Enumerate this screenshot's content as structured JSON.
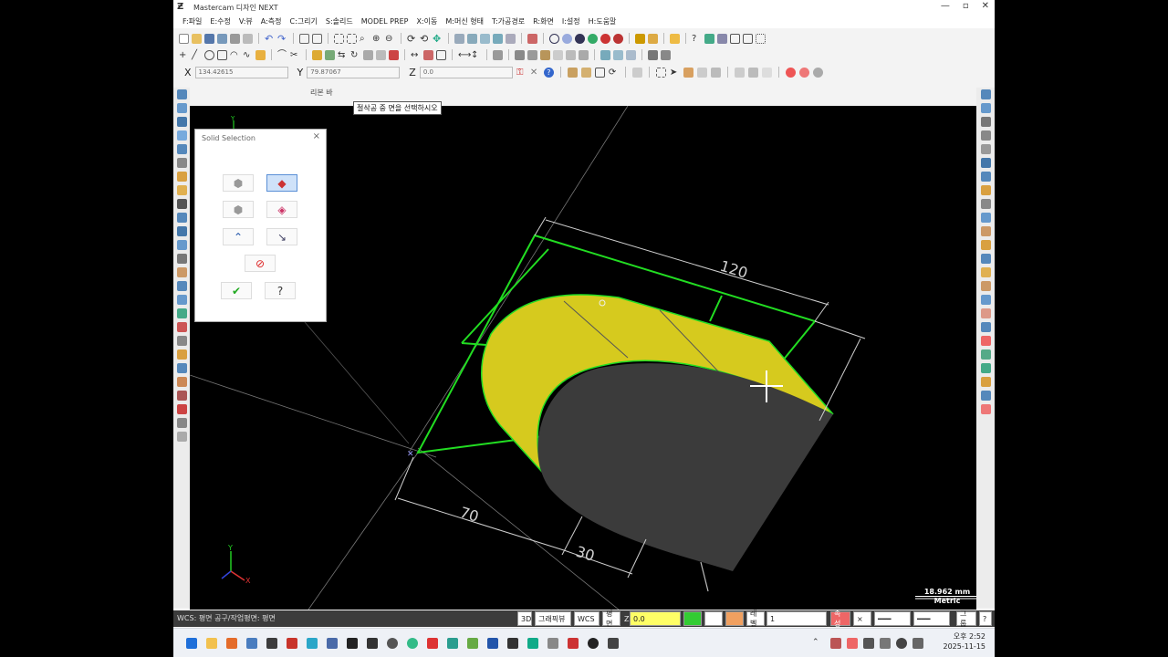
{
  "window": {
    "title": "Mastercam 디자인 NEXT",
    "controls": [
      "—",
      "▫",
      "✕"
    ]
  },
  "menu": [
    "F:파일",
    "E:수정",
    "V:뷰",
    "A:측정",
    "C:그리기",
    "S:솔리드",
    "MODEL PREP",
    "X:이동",
    "M:머신 형태",
    "T:가공경로",
    "R:화면",
    "I:설정",
    "H:도움말"
  ],
  "coords": {
    "x_label": "X",
    "x_value": "134.42615",
    "y_label": "Y",
    "y_value": "79.87067",
    "z_label": "Z",
    "z_value": "0.0"
  },
  "ribbon_label": "리본 바",
  "prompt": "절삭공 중 면을 선택하시오",
  "solid_selection": {
    "title": "Solid Selection",
    "close": "×",
    "ok_glyph": "✔",
    "help_glyph": "?"
  },
  "drawing": {
    "dim_120": "120",
    "dim_70": "70",
    "dim_30": "30",
    "scale_value": "18.962 mm",
    "scale_unit": "Metric",
    "colors": {
      "solid_top": "#d8cc1c",
      "solid_face": "#3a3a3a",
      "wire": "#22dd22",
      "dims": "#cccccc"
    }
  },
  "statusbar": {
    "wcs": "WCS: 평면  공구/작업평면: 평면",
    "mode_3d": "3D",
    "screen_view": "그래픽뷰",
    "wcs_btn": "WCS",
    "plane": "평면",
    "z_label": "Z",
    "z_value": "0.0",
    "level_label": "레벨",
    "level_value": "1",
    "attr_label": "속성",
    "group_label": "그룹",
    "help": "?"
  },
  "clock": {
    "time": "오후 2:52",
    "date": "2025-11-15"
  }
}
